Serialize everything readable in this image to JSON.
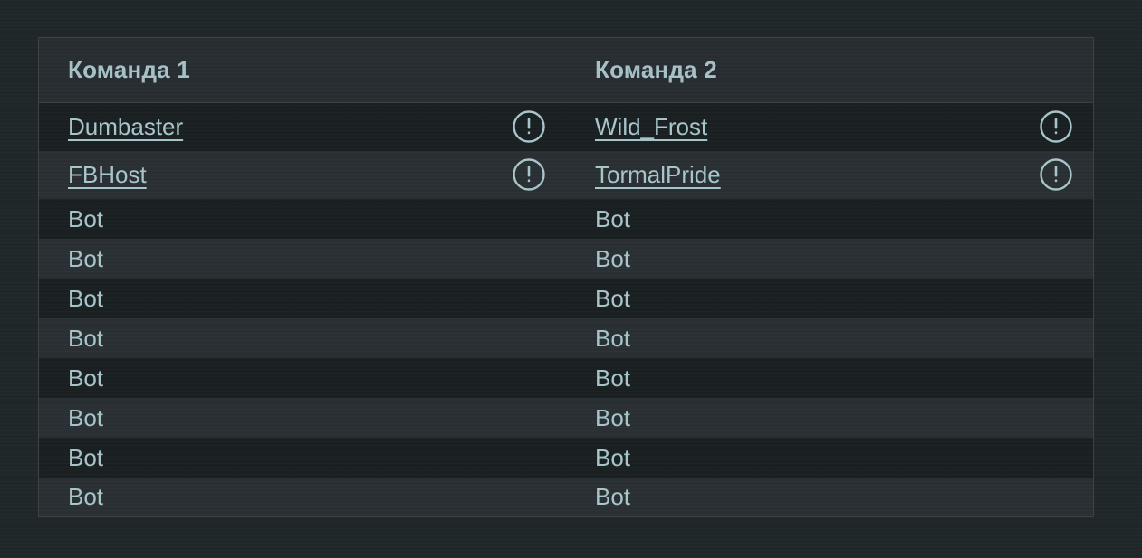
{
  "colors": {
    "page_background": "#212829",
    "table_border": "#3c4448",
    "header_background": "#282e31",
    "row_dark": "#1b2123",
    "row_light": "#2a3033",
    "text": "#a9c8cd",
    "header_text": "#a9c5ca",
    "icon": "#a9c8cd"
  },
  "table": {
    "headers": [
      {
        "label": "Команда 1"
      },
      {
        "label": "Команда 2"
      }
    ],
    "rows": [
      {
        "type": "player",
        "cells": [
          {
            "label": "Dumbaster",
            "link": true,
            "icon": "exclamation-circle-icon"
          },
          {
            "label": "Wild_Frost",
            "link": true,
            "icon": "exclamation-circle-icon"
          }
        ]
      },
      {
        "type": "player",
        "cells": [
          {
            "label": "FBHost",
            "link": true,
            "icon": "exclamation-circle-icon"
          },
          {
            "label": "TormalPride",
            "link": true,
            "icon": "exclamation-circle-icon"
          }
        ]
      },
      {
        "type": "bot",
        "cells": [
          {
            "label": "Bot",
            "link": false,
            "icon": null
          },
          {
            "label": "Bot",
            "link": false,
            "icon": null
          }
        ]
      },
      {
        "type": "bot",
        "cells": [
          {
            "label": "Bot",
            "link": false,
            "icon": null
          },
          {
            "label": "Bot",
            "link": false,
            "icon": null
          }
        ]
      },
      {
        "type": "bot",
        "cells": [
          {
            "label": "Bot",
            "link": false,
            "icon": null
          },
          {
            "label": "Bot",
            "link": false,
            "icon": null
          }
        ]
      },
      {
        "type": "bot",
        "cells": [
          {
            "label": "Bot",
            "link": false,
            "icon": null
          },
          {
            "label": "Bot",
            "link": false,
            "icon": null
          }
        ]
      },
      {
        "type": "bot",
        "cells": [
          {
            "label": "Bot",
            "link": false,
            "icon": null
          },
          {
            "label": "Bot",
            "link": false,
            "icon": null
          }
        ]
      },
      {
        "type": "bot",
        "cells": [
          {
            "label": "Bot",
            "link": false,
            "icon": null
          },
          {
            "label": "Bot",
            "link": false,
            "icon": null
          }
        ]
      },
      {
        "type": "bot",
        "cells": [
          {
            "label": "Bot",
            "link": false,
            "icon": null
          },
          {
            "label": "Bot",
            "link": false,
            "icon": null
          }
        ]
      },
      {
        "type": "bot",
        "cells": [
          {
            "label": "Bot",
            "link": false,
            "icon": null
          },
          {
            "label": "Bot",
            "link": false,
            "icon": null
          }
        ]
      }
    ]
  }
}
